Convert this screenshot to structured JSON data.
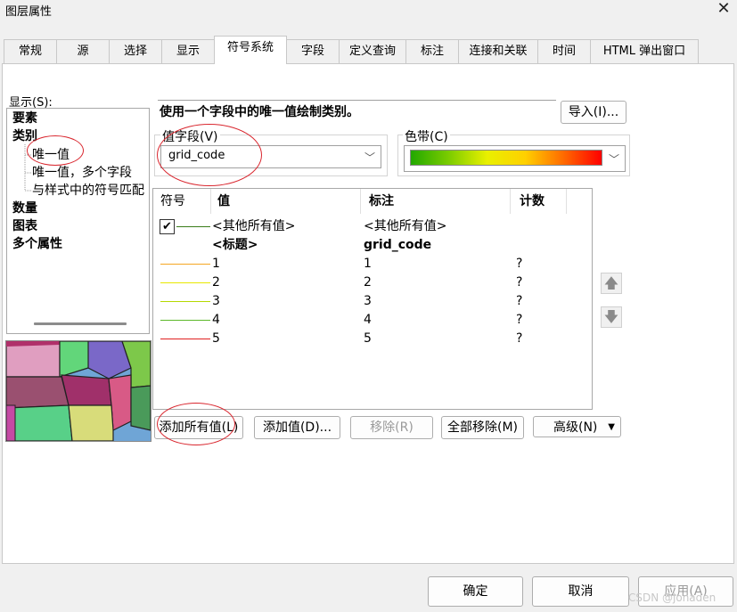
{
  "window": {
    "title": "图层属性",
    "close_glyph": "✕"
  },
  "tabs": [
    {
      "label": "常规"
    },
    {
      "label": "源"
    },
    {
      "label": "选择"
    },
    {
      "label": "显示"
    },
    {
      "label": "符号系统"
    },
    {
      "label": "字段"
    },
    {
      "label": "定义查询"
    },
    {
      "label": "标注"
    },
    {
      "label": "连接和关联"
    },
    {
      "label": "时间"
    },
    {
      "label": "HTML 弹出窗口"
    }
  ],
  "active_tab": "符号系统",
  "show_panel": {
    "label": "显示(S):",
    "items": [
      {
        "label": "要素",
        "level": 0
      },
      {
        "label": "类别",
        "level": 0
      },
      {
        "label": "唯一值",
        "level": 1,
        "selected": true
      },
      {
        "label": "唯一值，多个字段",
        "level": 1
      },
      {
        "label": "与样式中的符号匹配",
        "level": 1
      },
      {
        "label": "数量",
        "level": 0
      },
      {
        "label": "图表",
        "level": 0
      },
      {
        "label": "多个属性",
        "level": 0
      }
    ]
  },
  "description": "使用一个字段中的唯一值绘制类别。",
  "import_button": "导入(I)...",
  "value_field": {
    "label": "值字段(V)",
    "value": "grid_code"
  },
  "color_ramp": {
    "label": "色带(C)",
    "colors": [
      "#22a800",
      "#e9f000",
      "#ff0000"
    ]
  },
  "table": {
    "headers": [
      "符号",
      "值",
      "标注",
      "计数"
    ],
    "rows": [
      {
        "symbol_color": "#3a7d1a",
        "checked": true,
        "value": "<其他所有值>",
        "label": "<其他所有值>",
        "count": "",
        "bold": false
      },
      {
        "symbol_color": "",
        "checked": false,
        "value": "<标题>",
        "label": "grid_code",
        "count": "",
        "bold": true
      },
      {
        "symbol_color": "#f5a623",
        "value": "1",
        "label": "1",
        "count": "?"
      },
      {
        "symbol_color": "#e8e800",
        "value": "2",
        "label": "2",
        "count": "?"
      },
      {
        "symbol_color": "#b5d900",
        "value": "3",
        "label": "3",
        "count": "?"
      },
      {
        "symbol_color": "#5cb82a",
        "value": "4",
        "label": "4",
        "count": "?"
      },
      {
        "symbol_color": "#e02020",
        "value": "5",
        "label": "5",
        "count": "?"
      }
    ]
  },
  "buttons": {
    "add_all": "添加所有值(L)",
    "add_values": "添加值(D)...",
    "remove": "移除(R)",
    "remove_all": "全部移除(M)",
    "advanced": "高级(N)",
    "ok": "确定",
    "cancel": "取消",
    "apply": "应用(A)"
  },
  "watermark": "CSDN @jonaden"
}
